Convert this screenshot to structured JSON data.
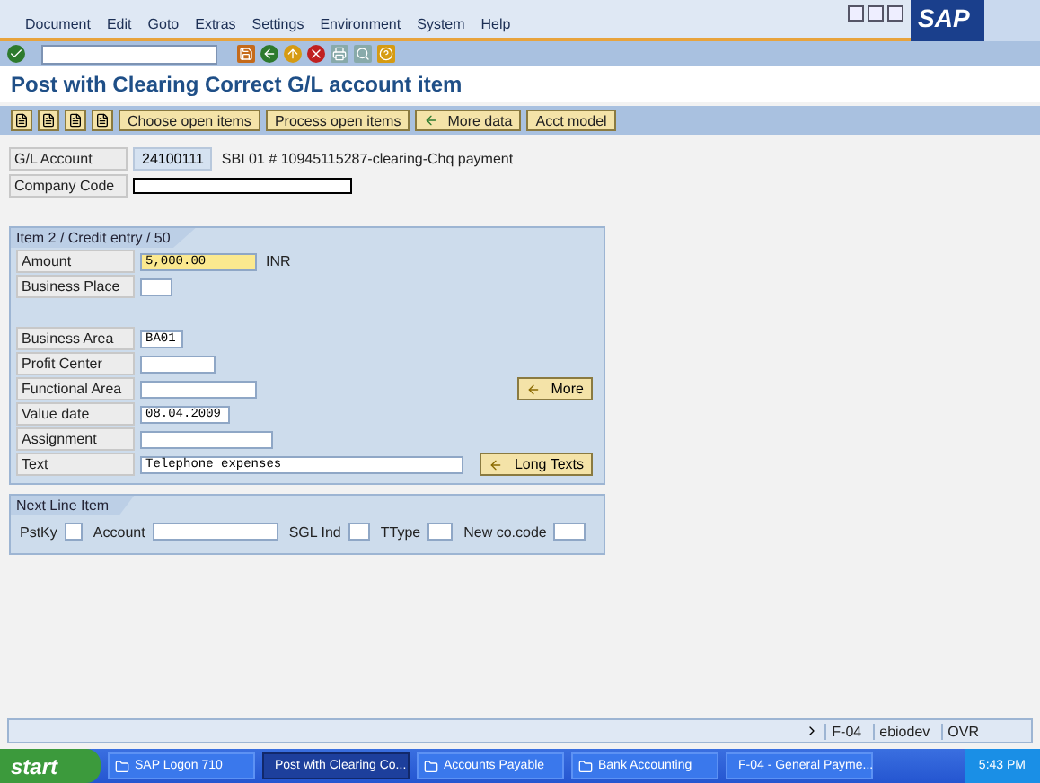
{
  "menu": [
    "Document",
    "Edit",
    "Goto",
    "Extras",
    "Settings",
    "Environment",
    "System",
    "Help"
  ],
  "logo": "SAP",
  "title": "Post with Clearing Correct G/L account item",
  "app_toolbar": [
    "Choose open items",
    "Process open items",
    "More data",
    "Acct model"
  ],
  "header": {
    "gl_label": "G/L Account",
    "gl_value": "24100111",
    "gl_text": "SBI 01 # 10945115287-clearing-Chq payment",
    "company_label": "Company Code"
  },
  "item_panel": {
    "title": "Item 2 / Credit entry / 50",
    "field_groups": [
      [
        {
          "label": "Amount",
          "value": "5,000.00",
          "required": true,
          "unit": "INR"
        },
        {
          "label": "Business Place",
          "required": false
        }
      ],
      [
        {
          "label": "Business Area",
          "value": "BA01",
          "required": false
        },
        {
          "label": "Profit Center",
          "required": false
        },
        {
          "label": "Functional Area",
          "required": false,
          "button": "More"
        },
        {
          "label": "Value date",
          "value": "08.04.2009",
          "required": false
        },
        {
          "label": "Assignment",
          "required": false
        },
        {
          "label": "Text",
          "value": "Telephone expenses",
          "required": false,
          "button": "Long Texts"
        }
      ]
    ]
  },
  "next_line": {
    "title": "Next Line Item",
    "fields": [
      "PstKy",
      "Account",
      "SGL Ind",
      "TType",
      "New co.code"
    ]
  },
  "status_bar": {
    "transaction": "F-04",
    "user": "ebiodev",
    "mode": "OVR"
  },
  "taskbar": {
    "start": "start",
    "tasks": [
      {
        "label": "SAP Logon 710",
        "selected": false
      },
      {
        "label": "Post with Clearing Co...",
        "selected": true
      },
      {
        "label": "Accounts Payable",
        "selected": false
      },
      {
        "label": "Bank Accounting",
        "selected": false
      },
      {
        "label": "F-04 - General Payme...",
        "selected": false
      }
    ],
    "clock": "5:43 PM"
  }
}
